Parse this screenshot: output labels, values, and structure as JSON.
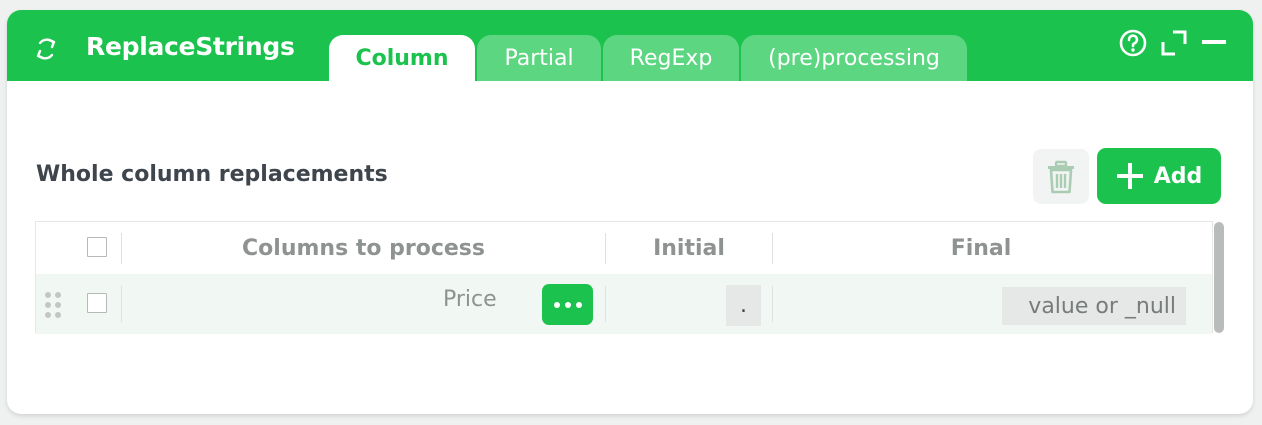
{
  "app": {
    "title": "ReplaceStrings",
    "icon": "refresh-arrows-icon"
  },
  "colors": {
    "accent": "#1bc34e",
    "tab_inactive": "#5cd681",
    "text_dark": "#3f454d",
    "text_muted": "#8e9391"
  },
  "tabs": [
    {
      "label": "Column",
      "active": true
    },
    {
      "label": "Partial",
      "active": false
    },
    {
      "label": "RegExp",
      "active": false
    },
    {
      "label": "(pre)processing",
      "active": false
    }
  ],
  "header_buttons": [
    "help-icon",
    "fullscreen-icon",
    "minimize-icon"
  ],
  "section": {
    "title": "Whole column replacements",
    "add_label": "Add"
  },
  "table": {
    "columns": [
      "Columns to process",
      "Initial",
      "Final"
    ],
    "rows": [
      {
        "column": "Price",
        "initial": ".",
        "final_placeholder": "value or _null"
      }
    ]
  }
}
